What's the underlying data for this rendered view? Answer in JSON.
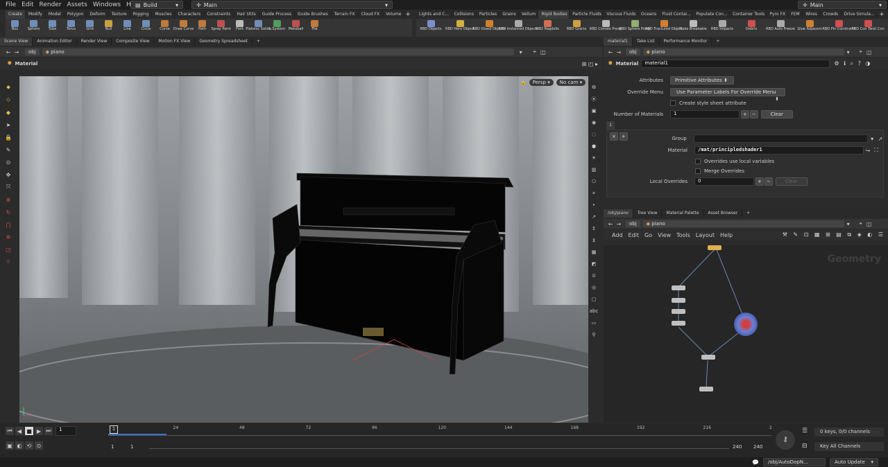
{
  "menubar": {
    "items": [
      "File",
      "Edit",
      "Render",
      "Assets",
      "Windows",
      "Help"
    ],
    "desktop": "Build",
    "context": "Main",
    "right_context": "Main"
  },
  "shelf_left": {
    "tabs": [
      "Create",
      "Modify",
      "Model",
      "Polygon",
      "Deform",
      "Texture",
      "Rigging",
      "Muscles",
      "Characters",
      "Constraints",
      "Hair Utils",
      "Guide Process",
      "Guide Brushes",
      "Terrain FX",
      "Cloud FX",
      "Volume"
    ],
    "tools": [
      {
        "label": "Box",
        "icon": "box-icon",
        "color": "#6f8fb8"
      },
      {
        "label": "Sphere",
        "icon": "sphere-icon",
        "color": "#6f8fb8"
      },
      {
        "label": "Tube",
        "icon": "tube-icon",
        "color": "#6f8fb8"
      },
      {
        "label": "Torus",
        "icon": "torus-icon",
        "color": "#6f8fb8"
      },
      {
        "label": "Grid",
        "icon": "grid-icon",
        "color": "#6f8fb8"
      },
      {
        "label": "Null",
        "icon": "null-icon",
        "color": "#c8a040"
      },
      {
        "label": "Line",
        "icon": "line-icon",
        "color": "#6f8fb8"
      },
      {
        "label": "Circle",
        "icon": "circle-icon",
        "color": "#6f8fb8"
      },
      {
        "label": "Curve",
        "icon": "curve-icon",
        "color": "#c07a3a"
      },
      {
        "label": "Draw Curve",
        "icon": "draw-curve-icon",
        "color": "#c07a3a"
      },
      {
        "label": "Path",
        "icon": "path-icon",
        "color": "#c07a3a"
      },
      {
        "label": "Spray Paint",
        "icon": "spray-paint-icon",
        "color": "#c05050"
      },
      {
        "label": "Font",
        "icon": "font-icon",
        "color": "#bbbbbb"
      },
      {
        "label": "Platonic Solids",
        "icon": "platonic-icon",
        "color": "#6f8fb8"
      },
      {
        "label": "L-System",
        "icon": "lsystem-icon",
        "color": "#4f9f5f"
      },
      {
        "label": "Metaball",
        "icon": "metaball-icon",
        "color": "#c05050"
      },
      {
        "label": "File",
        "icon": "file-icon",
        "color": "#c07a3a"
      }
    ]
  },
  "shelf_right": {
    "tabs": [
      "Lights and C...",
      "Collisions",
      "Particles",
      "Grains",
      "Vellum",
      "Rigid Bodies",
      "Particle Fluids",
      "Viscous Fluids",
      "Oceans",
      "Fluid Contai...",
      "Populate Con...",
      "Container Tools",
      "Pyro FX",
      "FEM",
      "Wires",
      "Crowds",
      "Drive Simula..."
    ],
    "tools": [
      {
        "label": "RBD Objects",
        "icon": "rbd-objects-icon",
        "color": "#7a8fd0"
      },
      {
        "label": "RBD Hero Object",
        "icon": "rbd-hero-icon",
        "color": "#d0b040"
      },
      {
        "label": "RBD Glued Objects",
        "icon": "rbd-glued-icon",
        "color": "#d08030"
      },
      {
        "label": "RBD Instanced Objects",
        "icon": "rbd-instanced-icon",
        "color": "#aaaaaa"
      },
      {
        "label": "RBD Ragdolls",
        "icon": "rbd-ragdolls-icon",
        "color": "#d07050"
      },
      {
        "label": "RBD Grains",
        "icon": "rbd-grains-icon",
        "color": "#d0a040"
      },
      {
        "label": "RBD Convex Proxy",
        "icon": "rbd-convex-icon",
        "color": "#bbbbbb"
      },
      {
        "label": "RBD Sphere Proxy",
        "icon": "rbd-sphere-icon",
        "color": "#8fb070"
      },
      {
        "label": "RBD Fractured Object",
        "icon": "rbd-fractured-icon",
        "color": "#d08030"
      },
      {
        "label": "Make Breakable",
        "icon": "make-breakable-icon",
        "color": "#bbbbbb"
      },
      {
        "label": "RBD Impacts",
        "icon": "rbd-impacts-icon",
        "color": "#aaaaaa"
      },
      {
        "label": "Debris",
        "icon": "debris-icon",
        "color": "#d05050"
      },
      {
        "label": "RBD Auto Freeze",
        "icon": "rbd-freeze-icon",
        "color": "#aaaaaa"
      },
      {
        "label": "Glue Adjacent",
        "icon": "glue-adjacent-icon",
        "color": "#d08030"
      },
      {
        "label": "RBD Pin Constraint",
        "icon": "pin-constraint-icon",
        "color": "#d05050"
      },
      {
        "label": "RBD Con Twist Con",
        "icon": "twist-con-icon",
        "color": "#d05050"
      }
    ]
  },
  "viewport": {
    "tabs": [
      "Scene View",
      "Animation Editor",
      "Render View",
      "Composite View",
      "Motion FX View",
      "Geometry Spreadsheet"
    ],
    "path": [
      "obj",
      "piano"
    ],
    "tool_name": "Material",
    "persp": "Persp",
    "cam": "No cam"
  },
  "params": {
    "tabs": [
      "material1",
      "Take List",
      "Performance Monitor"
    ],
    "path": [
      "obj",
      "piano"
    ],
    "node_type": "Material",
    "node_name": "material1",
    "attributes_label": "Attributes",
    "attributes_value": "Primitive Attributes",
    "override_label": "Override Menu",
    "override_value": "Use Parameter Labels For Override Menu",
    "style_sheet_label": "Create style sheet attribute",
    "num_materials_label": "Number of Materials",
    "num_materials_value": "1",
    "clear_label": "Clear",
    "instance_tab": "1",
    "group_label": "Group",
    "group_value": "",
    "material_label": "Material",
    "material_value": "/mat/principledshader1",
    "overrides_local_label": "Overrides use local variables",
    "merge_overrides_label": "Merge Overrides",
    "local_overrides_label": "Local Overrides",
    "local_overrides_value": "0",
    "local_clear_label": "Clear"
  },
  "network": {
    "tabs": [
      "/obj/piano",
      "Tree View",
      "Material Palette",
      "Asset Browser"
    ],
    "path": [
      "obj",
      "piano"
    ],
    "menu": [
      "Add",
      "Edit",
      "Go",
      "View",
      "Tools",
      "Layout",
      "Help"
    ],
    "context_label": "Geometry"
  },
  "timeline": {
    "frame": "1",
    "ticks": [
      "1",
      "24",
      "48",
      "72",
      "96",
      "120",
      "144",
      "168",
      "192",
      "216",
      "2"
    ],
    "start": "1",
    "start2": "1",
    "end": "240",
    "end2": "240",
    "keys_info": "0 keys, 0/0 channels",
    "key_all": "Key All Channels"
  },
  "status": {
    "path": "/obj/AutoDopN...",
    "update": "Auto Update"
  }
}
